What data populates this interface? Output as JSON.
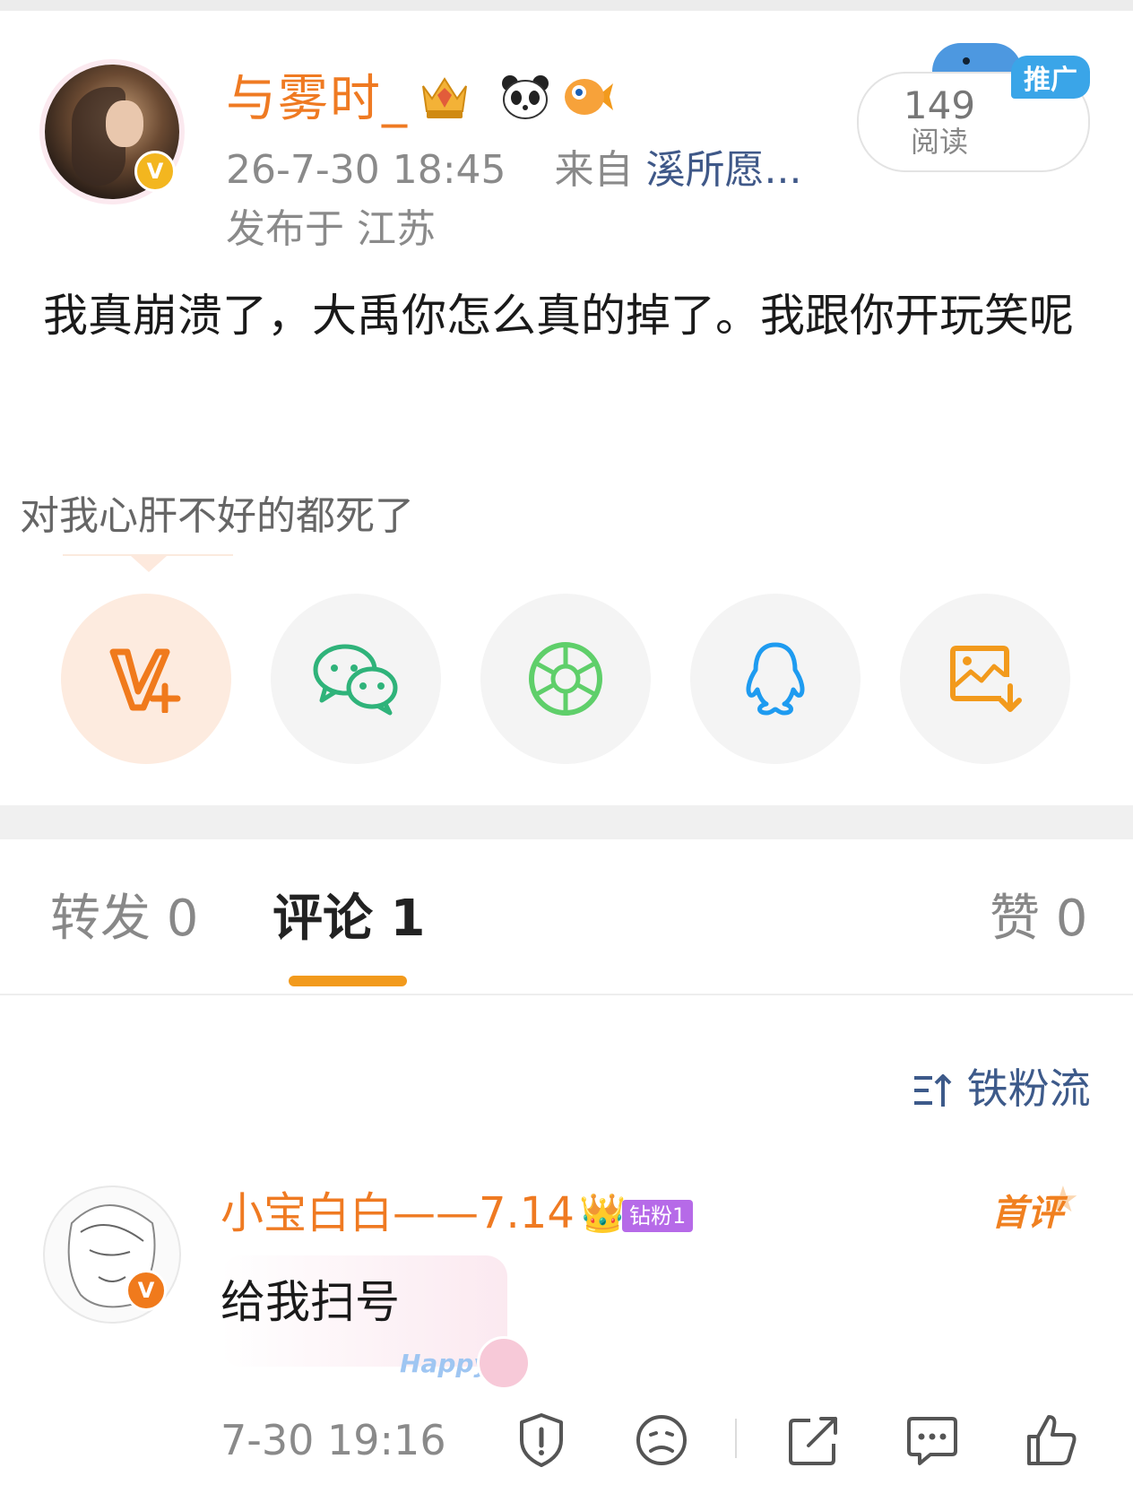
{
  "post": {
    "username": "与雾时_",
    "timestamp": "26-7-30 18:45",
    "source_prefix": "来自",
    "source": "溪所愿...",
    "location": "发布于 江苏",
    "read_count": "149",
    "read_label": "阅读",
    "promo_label": "推广",
    "text": "我真崩溃了，大禹你怎么真的掉了。我跟你开玩笑呢",
    "subtext": "对我心肝不好的都死了",
    "badges": [
      "crown-badge-icon",
      "panda-icon",
      "fish-icon"
    ]
  },
  "share": {
    "items": [
      {
        "name": "weibo-share-icon",
        "color": "#f07a1c"
      },
      {
        "name": "wechat-icon",
        "color": "#2fb37a"
      },
      {
        "name": "moments-icon",
        "color": "#5fcf6a"
      },
      {
        "name": "qq-icon",
        "color": "#1e9bf0"
      },
      {
        "name": "save-image-icon",
        "color": "#f29a1c"
      }
    ]
  },
  "tabs": {
    "repost": "转发 0",
    "comment": "评论 1",
    "like": "赞 0"
  },
  "sort_label": "铁粉流",
  "comment": {
    "username": "小宝白白——7.14",
    "fan_badge": "钻粉1",
    "first_label": "首评",
    "text": "给我扫号",
    "sticker_text": "Happy",
    "time": "7-30 19:16"
  },
  "colors": {
    "accent": "#ef7a22",
    "link": "#3f5888",
    "tab_underline": "#f29a1c",
    "promo": "#3aa5e8"
  }
}
